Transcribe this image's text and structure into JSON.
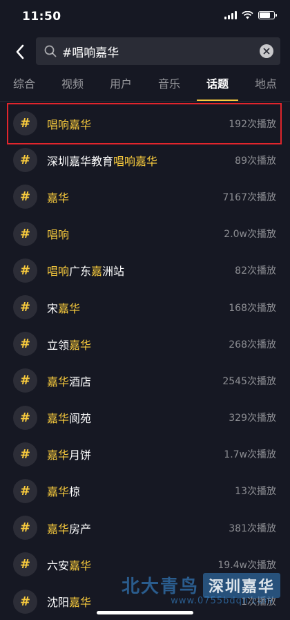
{
  "status_bar": {
    "time": "11:50",
    "battery_level": 0.8
  },
  "search": {
    "query": "#唱响嘉华"
  },
  "tabs": [
    {
      "label": "综合",
      "active": false
    },
    {
      "label": "视频",
      "active": false
    },
    {
      "label": "用户",
      "active": false
    },
    {
      "label": "音乐",
      "active": false
    },
    {
      "label": "话题",
      "active": true
    },
    {
      "label": "地点",
      "active": false
    }
  ],
  "topics": [
    {
      "parts": [
        {
          "t": "唱响嘉华",
          "h": true
        }
      ],
      "plays": "192次播放",
      "selected": true
    },
    {
      "parts": [
        {
          "t": "深圳嘉华教育",
          "h": false
        },
        {
          "t": "唱响嘉华",
          "h": true
        }
      ],
      "plays": "89次播放"
    },
    {
      "parts": [
        {
          "t": "嘉华",
          "h": true
        }
      ],
      "plays": "7167次播放"
    },
    {
      "parts": [
        {
          "t": "唱响",
          "h": true
        }
      ],
      "plays": "2.0w次播放"
    },
    {
      "parts": [
        {
          "t": "唱响",
          "h": true
        },
        {
          "t": "广东",
          "h": false
        },
        {
          "t": "嘉",
          "h": true
        },
        {
          "t": "洲站",
          "h": false
        }
      ],
      "plays": "82次播放"
    },
    {
      "parts": [
        {
          "t": "宋",
          "h": false
        },
        {
          "t": "嘉华",
          "h": true
        }
      ],
      "plays": "168次播放"
    },
    {
      "parts": [
        {
          "t": "立领",
          "h": false
        },
        {
          "t": "嘉华",
          "h": true
        }
      ],
      "plays": "268次播放"
    },
    {
      "parts": [
        {
          "t": "嘉华",
          "h": true
        },
        {
          "t": "酒店",
          "h": false
        }
      ],
      "plays": "2545次播放"
    },
    {
      "parts": [
        {
          "t": "嘉华",
          "h": true
        },
        {
          "t": "阆苑",
          "h": false
        }
      ],
      "plays": "329次播放"
    },
    {
      "parts": [
        {
          "t": "嘉华",
          "h": true
        },
        {
          "t": "月饼",
          "h": false
        }
      ],
      "plays": "1.7w次播放"
    },
    {
      "parts": [
        {
          "t": "嘉华",
          "h": true
        },
        {
          "t": "椋",
          "h": false
        }
      ],
      "plays": "13次播放"
    },
    {
      "parts": [
        {
          "t": "嘉华",
          "h": true
        },
        {
          "t": "房产",
          "h": false
        }
      ],
      "plays": "381次播放"
    },
    {
      "parts": [
        {
          "t": "六安",
          "h": false
        },
        {
          "t": "嘉华",
          "h": true
        }
      ],
      "plays": "19.4w次播放"
    },
    {
      "parts": [
        {
          "t": "沈阳",
          "h": false
        },
        {
          "t": "嘉华",
          "h": true
        }
      ],
      "plays": "1次播放"
    }
  ],
  "watermark": {
    "brand": "北大青鸟",
    "tag": "深圳嘉华",
    "url": "www.0755bdqn.com"
  },
  "colors": {
    "background": "#161823",
    "accent": "#facc3d",
    "selection_border": "#e1252c"
  }
}
